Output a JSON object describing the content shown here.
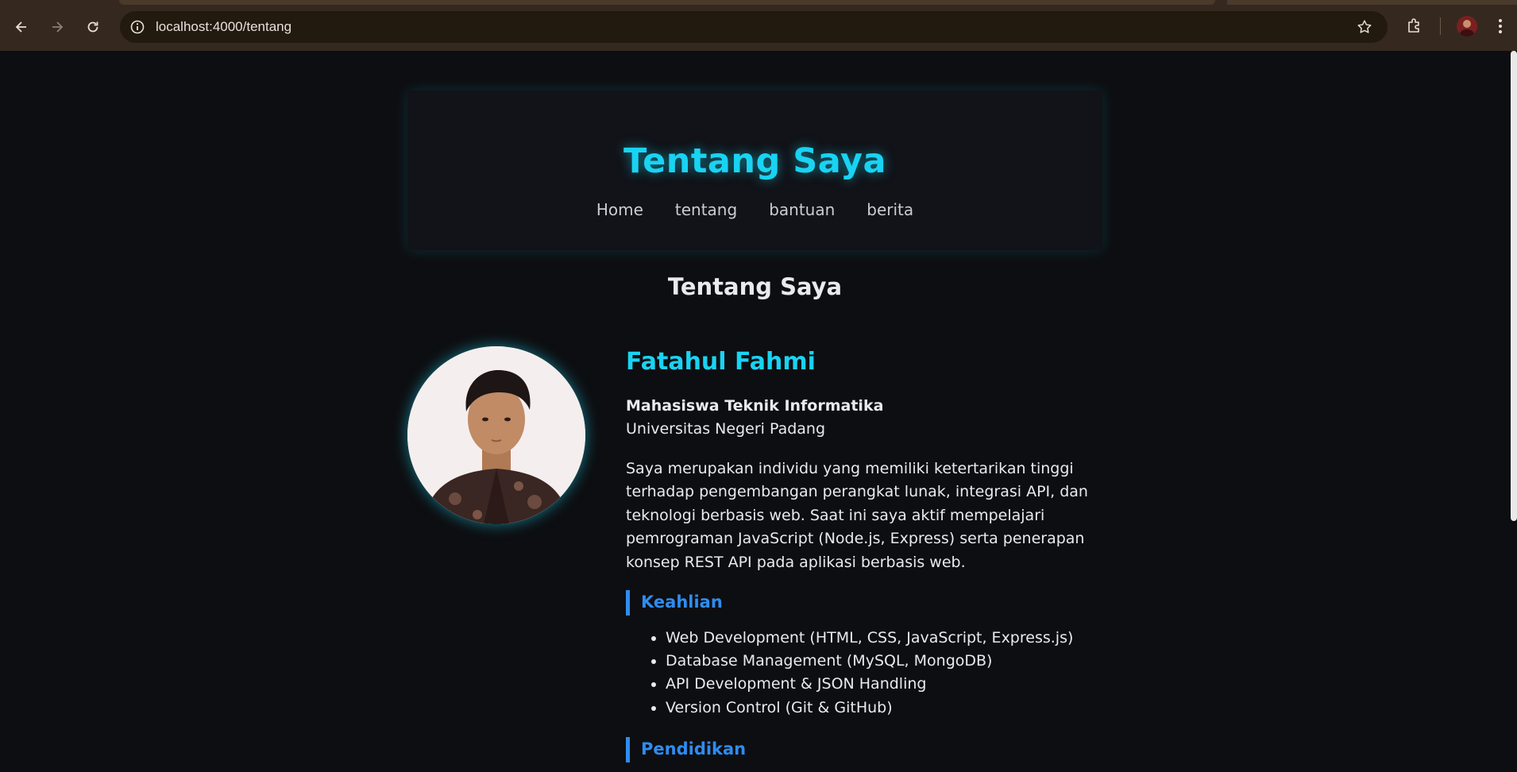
{
  "browser": {
    "url": "localhost:4000/tentang",
    "icons": [
      "back-icon",
      "forward-icon",
      "reload-icon",
      "site-info-icon",
      "bookmark-star-icon",
      "extensions-icon",
      "profile-avatar",
      "more-menu-icon"
    ]
  },
  "header": {
    "title": "Tentang Saya",
    "nav": [
      "Home",
      "tentang",
      "bantuan",
      "berita"
    ]
  },
  "main": {
    "section_title": "Tentang Saya",
    "profile": {
      "name": "Fatahul Fahmi",
      "role": "Mahasiswa Teknik Informatika",
      "university": "Universitas Negeri Padang",
      "description": "Saya merupakan individu yang memiliki ketertarikan tinggi terhadap pengembangan perangkat lunak, integrasi API, dan teknologi berbasis web. Saat ini saya aktif mempelajari pemrograman JavaScript (Node.js, Express) serta penerapan konsep REST API pada aplikasi berbasis web."
    },
    "skills_heading": "Keahlian",
    "skills": [
      "Web Development (HTML, CSS, JavaScript, Express.js)",
      "Database Management (MySQL, MongoDB)",
      "API Development & JSON Handling",
      "Version Control (Git & GitHub)"
    ],
    "education_heading": "Pendidikan"
  },
  "colors": {
    "accent_cyan": "#19d3f2",
    "accent_blue": "#2f8cf0",
    "background": "#0d0e11",
    "card": "#111318"
  }
}
